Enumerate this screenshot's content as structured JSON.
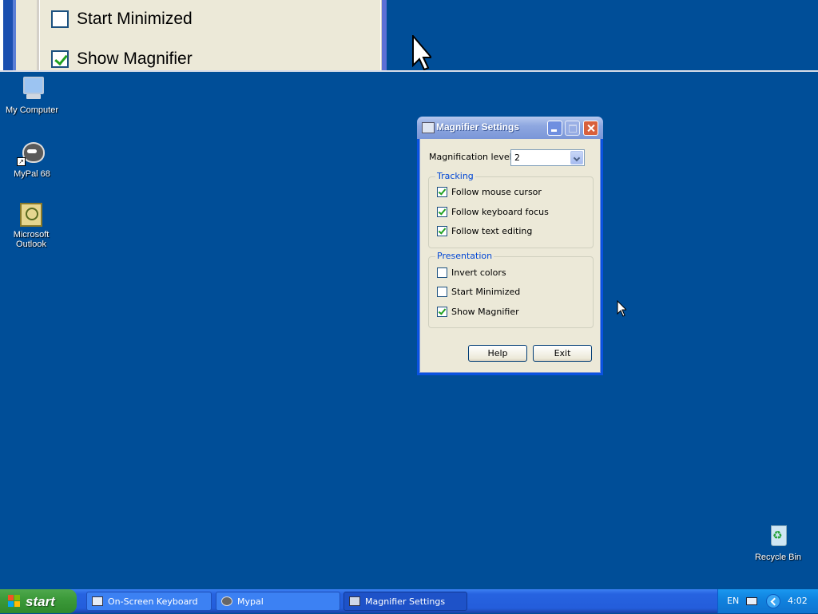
{
  "magnifier_pane": {
    "items": [
      {
        "label": "Start Minimized",
        "checked": false
      },
      {
        "label": "Show Magnifier",
        "checked": true
      }
    ]
  },
  "desktop": {
    "icons": [
      {
        "label": "My Computer",
        "icon": "my-computer-icon"
      },
      {
        "label": "MyPal 68",
        "icon": "mypal-icon"
      },
      {
        "label": "Microsoft Outlook",
        "icon": "outlook-icon"
      },
      {
        "label": "Recycle Bin",
        "icon": "recycle-bin-icon"
      }
    ]
  },
  "window": {
    "title": "Magnifier Settings",
    "magnification_label": "Magnification level:",
    "magnification_value": "2",
    "tracking": {
      "title": "Tracking",
      "options": [
        {
          "label": "Follow mouse cursor",
          "checked": true
        },
        {
          "label": "Follow keyboard focus",
          "checked": true
        },
        {
          "label": "Follow text editing",
          "checked": true
        }
      ]
    },
    "presentation": {
      "title": "Presentation",
      "options": [
        {
          "label": "Invert colors",
          "checked": false
        },
        {
          "label": "Start Minimized",
          "checked": false
        },
        {
          "label": "Show Magnifier",
          "checked": true
        }
      ]
    },
    "help_label": "Help",
    "exit_label": "Exit"
  },
  "taskbar": {
    "start_label": "start",
    "tasks": [
      {
        "label": "On-Screen Keyboard",
        "icon": "keyboard-icon",
        "active": false
      },
      {
        "label": "Mypal",
        "icon": "mypal-icon",
        "active": false
      },
      {
        "label": "Magnifier Settings",
        "icon": "magnifier-icon",
        "active": true
      }
    ],
    "tray": {
      "language": "EN",
      "time": "4:02"
    }
  },
  "colors": {
    "desktop": "#004e98",
    "accent": "#0046d5",
    "check": "#21a121"
  }
}
